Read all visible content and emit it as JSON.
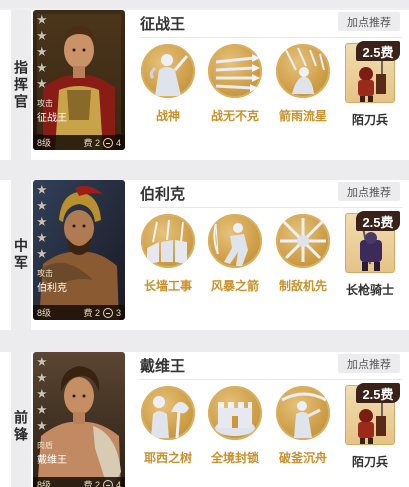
{
  "recommend_label": "加点推荐",
  "cards": [
    {
      "role": "指挥官",
      "stars": 5,
      "portrait": {
        "type_label": "攻击",
        "name": "征战王",
        "level": "8级",
        "cost": "费 2",
        "count": "4"
      },
      "general_name": "征战王",
      "skills": [
        {
          "label": "战神",
          "icon": "warrior-statue-icon"
        },
        {
          "label": "战无不克",
          "icon": "spear-volley-icon"
        },
        {
          "label": "箭雨流星",
          "icon": "arrow-rain-icon"
        }
      ],
      "troop": {
        "cost": "2.5费",
        "label": "陌刀兵",
        "icon": "blade-infantry-icon"
      }
    },
    {
      "role": "中军",
      "stars": 5,
      "portrait": {
        "type_label": "攻击",
        "name": "伯利克",
        "level": "8级",
        "cost": "费 2",
        "count": "3"
      },
      "general_name": "伯利克",
      "skills": [
        {
          "label": "长墙工事",
          "icon": "shield-wall-icon"
        },
        {
          "label": "风暴之箭",
          "icon": "storm-archer-icon"
        },
        {
          "label": "制敌机先",
          "icon": "crossed-blades-icon"
        }
      ],
      "troop": {
        "cost": "2.5费",
        "label": "长枪骑士",
        "icon": "lancer-knight-icon"
      }
    },
    {
      "role": "前锋",
      "stars": 5,
      "portrait": {
        "type_label": "肉盾",
        "name": "戴维王",
        "level": "8级",
        "cost": "费 2",
        "count": "4"
      },
      "general_name": "戴维王",
      "skills": [
        {
          "label": "耶西之树",
          "icon": "tree-figure-icon"
        },
        {
          "label": "全境封锁",
          "icon": "fortress-icon"
        },
        {
          "label": "破釜沉舟",
          "icon": "charging-warrior-icon"
        }
      ],
      "troop": {
        "cost": "2.5费",
        "label": "陌刀兵",
        "icon": "blade-infantry-icon"
      }
    }
  ]
}
